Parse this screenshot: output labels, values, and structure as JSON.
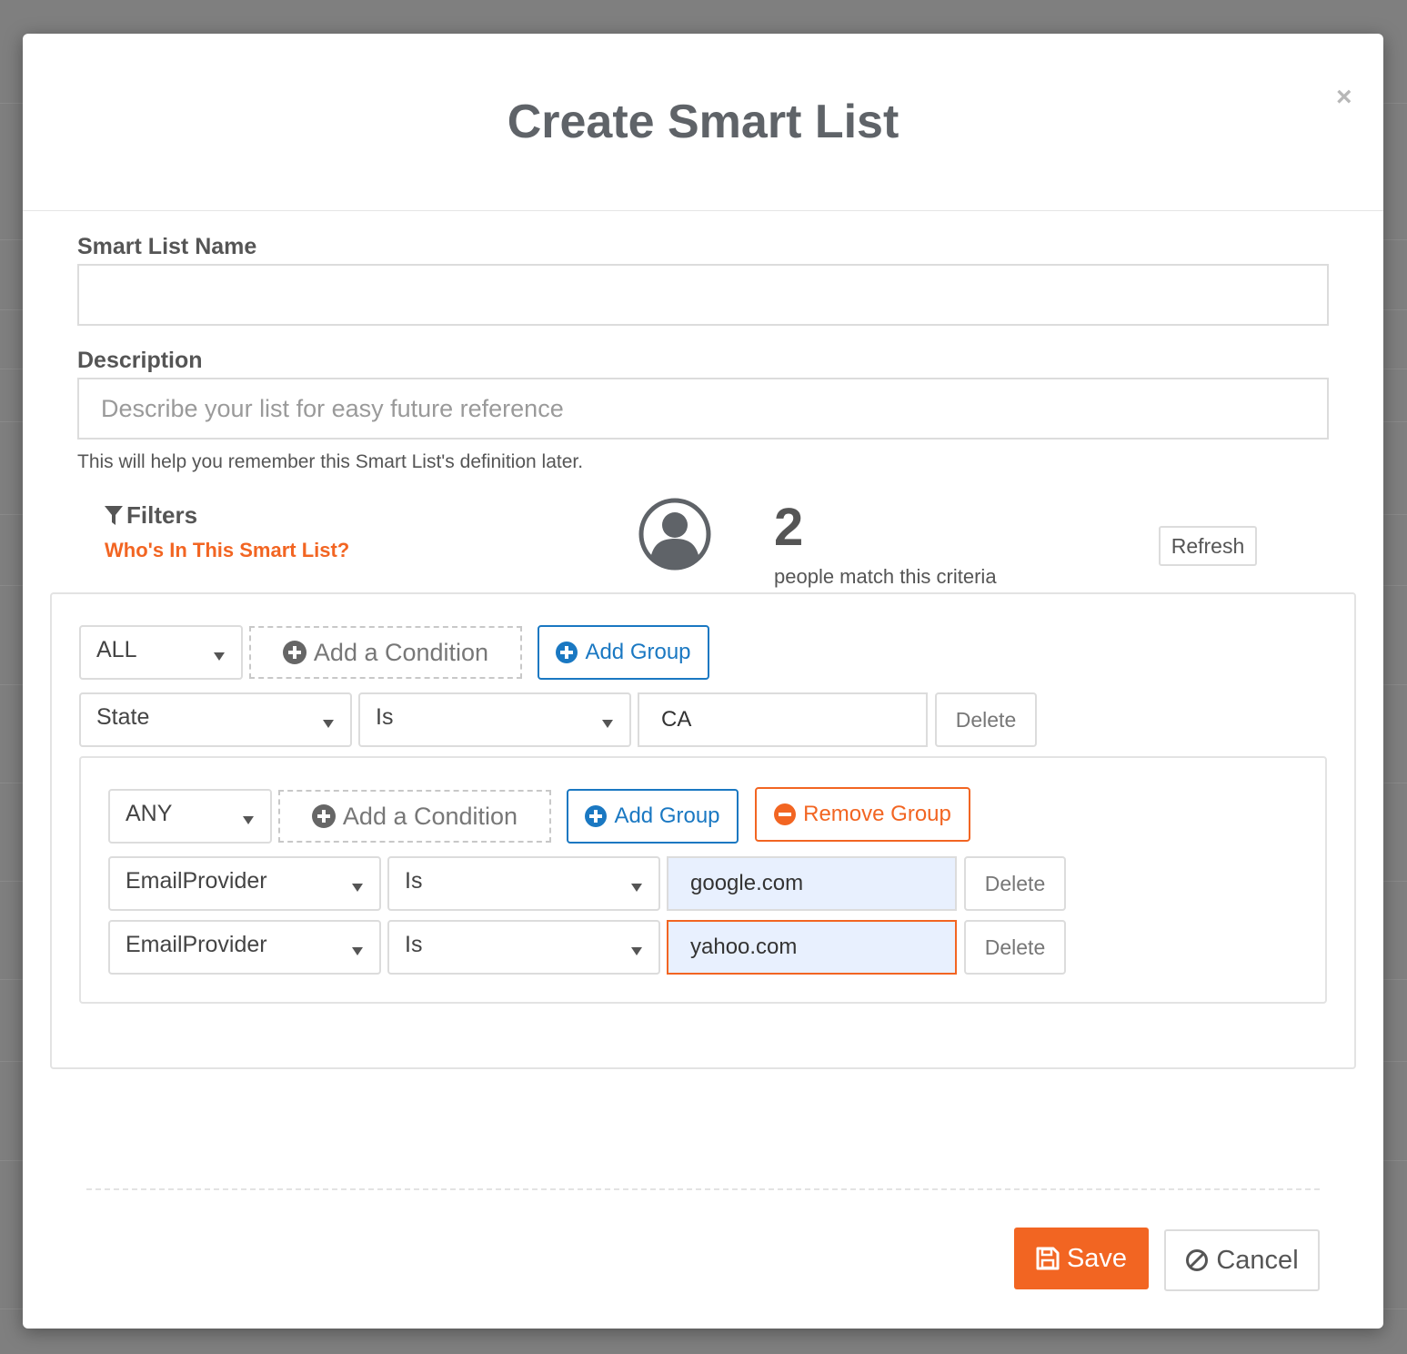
{
  "modal": {
    "title": "Create Smart List",
    "close_symbol": "×"
  },
  "form": {
    "name_label": "Smart List Name",
    "name_value": "",
    "description_label": "Description",
    "description_value": "",
    "description_placeholder": "Describe your list for easy future reference",
    "description_help": "This will help you remember this Smart List's definition later."
  },
  "filters": {
    "label": "Filters",
    "whos_in_link": "Who's In This Smart List?",
    "match_count": "2",
    "match_text": "people match this criteria",
    "refresh_label": "Refresh"
  },
  "root_group": {
    "match_mode": "ALL",
    "add_condition_label": "Add a Condition",
    "add_group_label": "Add Group",
    "conditions": [
      {
        "field": "State",
        "operator": "Is",
        "value": "CA",
        "delete_label": "Delete"
      }
    ]
  },
  "sub_group": {
    "match_mode": "ANY",
    "add_condition_label": "Add a Condition",
    "add_group_label": "Add Group",
    "remove_group_label": "Remove Group",
    "conditions": [
      {
        "field": "EmailProvider",
        "operator": "Is",
        "value": "google.com",
        "delete_label": "Delete"
      },
      {
        "field": "EmailProvider",
        "operator": "Is",
        "value": "yahoo.com",
        "delete_label": "Delete"
      }
    ]
  },
  "footer": {
    "save_label": "Save",
    "cancel_label": "Cancel"
  },
  "colors": {
    "accent_orange": "#f26522",
    "accent_blue": "#1a78c2",
    "filled_input": "#e8f0fe"
  },
  "icons": [
    "close-icon",
    "filter-icon",
    "user-avatar-icon",
    "plus-circle-icon",
    "minus-circle-icon",
    "caret-down-icon",
    "save-icon",
    "cancel-icon"
  ]
}
